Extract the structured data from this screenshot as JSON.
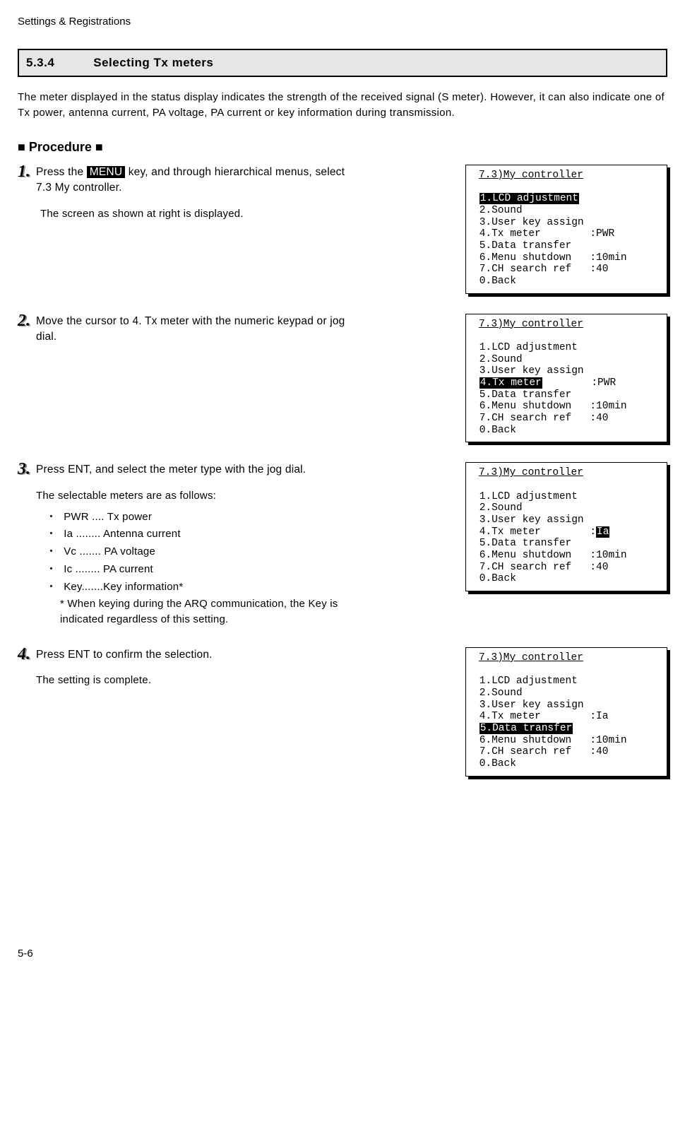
{
  "page": {
    "header": "Settings & Registrations",
    "section_number": "5.3.4",
    "section_title": "Selecting Tx meters",
    "intro": "The meter displayed in the status display indicates the strength of the received signal (S meter). However, it can also indicate one of Tx power, antenna current, PA voltage, PA current or key information during transmission.",
    "procedure_heading": "■ Procedure ■",
    "page_number": "5-6"
  },
  "step1": {
    "num": "1.",
    "text_before": "Press the ",
    "menu_key": "MENU",
    "text_after": " key, and through hierarchical menus, select 7.3 My controller.",
    "sub": "The screen as shown at right is displayed."
  },
  "step2": {
    "num": "2.",
    "text": "Move the cursor to 4. Tx meter with the numeric keypad or jog dial."
  },
  "step3": {
    "num": "3.",
    "text": "Press ENT, and select the meter type with the jog dial.",
    "sub": "The selectable meters are as follows:",
    "meters": [
      {
        "label": "PWR .... Tx power"
      },
      {
        "label": "Ia ........ Antenna current"
      },
      {
        "label": "Vc ....... PA voltage"
      },
      {
        "label": "Ic ........ PA current"
      },
      {
        "label": "Key.......Key information*"
      }
    ],
    "note": "*  When keying during the ARQ communication, the Key is indicated regardless of this setting."
  },
  "step4": {
    "num": "4.",
    "text": "Press ENT to confirm the selection.",
    "sub": "The setting is complete."
  },
  "screens": {
    "title": "7.3)My controller",
    "items": {
      "lcd": "1.LCD adjustment",
      "sound": "2.Sound",
      "userkey": "3.User key assign",
      "txmeter": "4.Tx meter",
      "datatrans": "5.Data transfer",
      "menushut": "6.Menu shutdown",
      "chsearch": "7.CH search ref",
      "back": "0.Back"
    },
    "vals": {
      "pwr": ":PWR",
      "ia_inv": "Ia",
      "ia": ":Ia",
      "tenmin": ":10min",
      "forty": ":40"
    }
  }
}
